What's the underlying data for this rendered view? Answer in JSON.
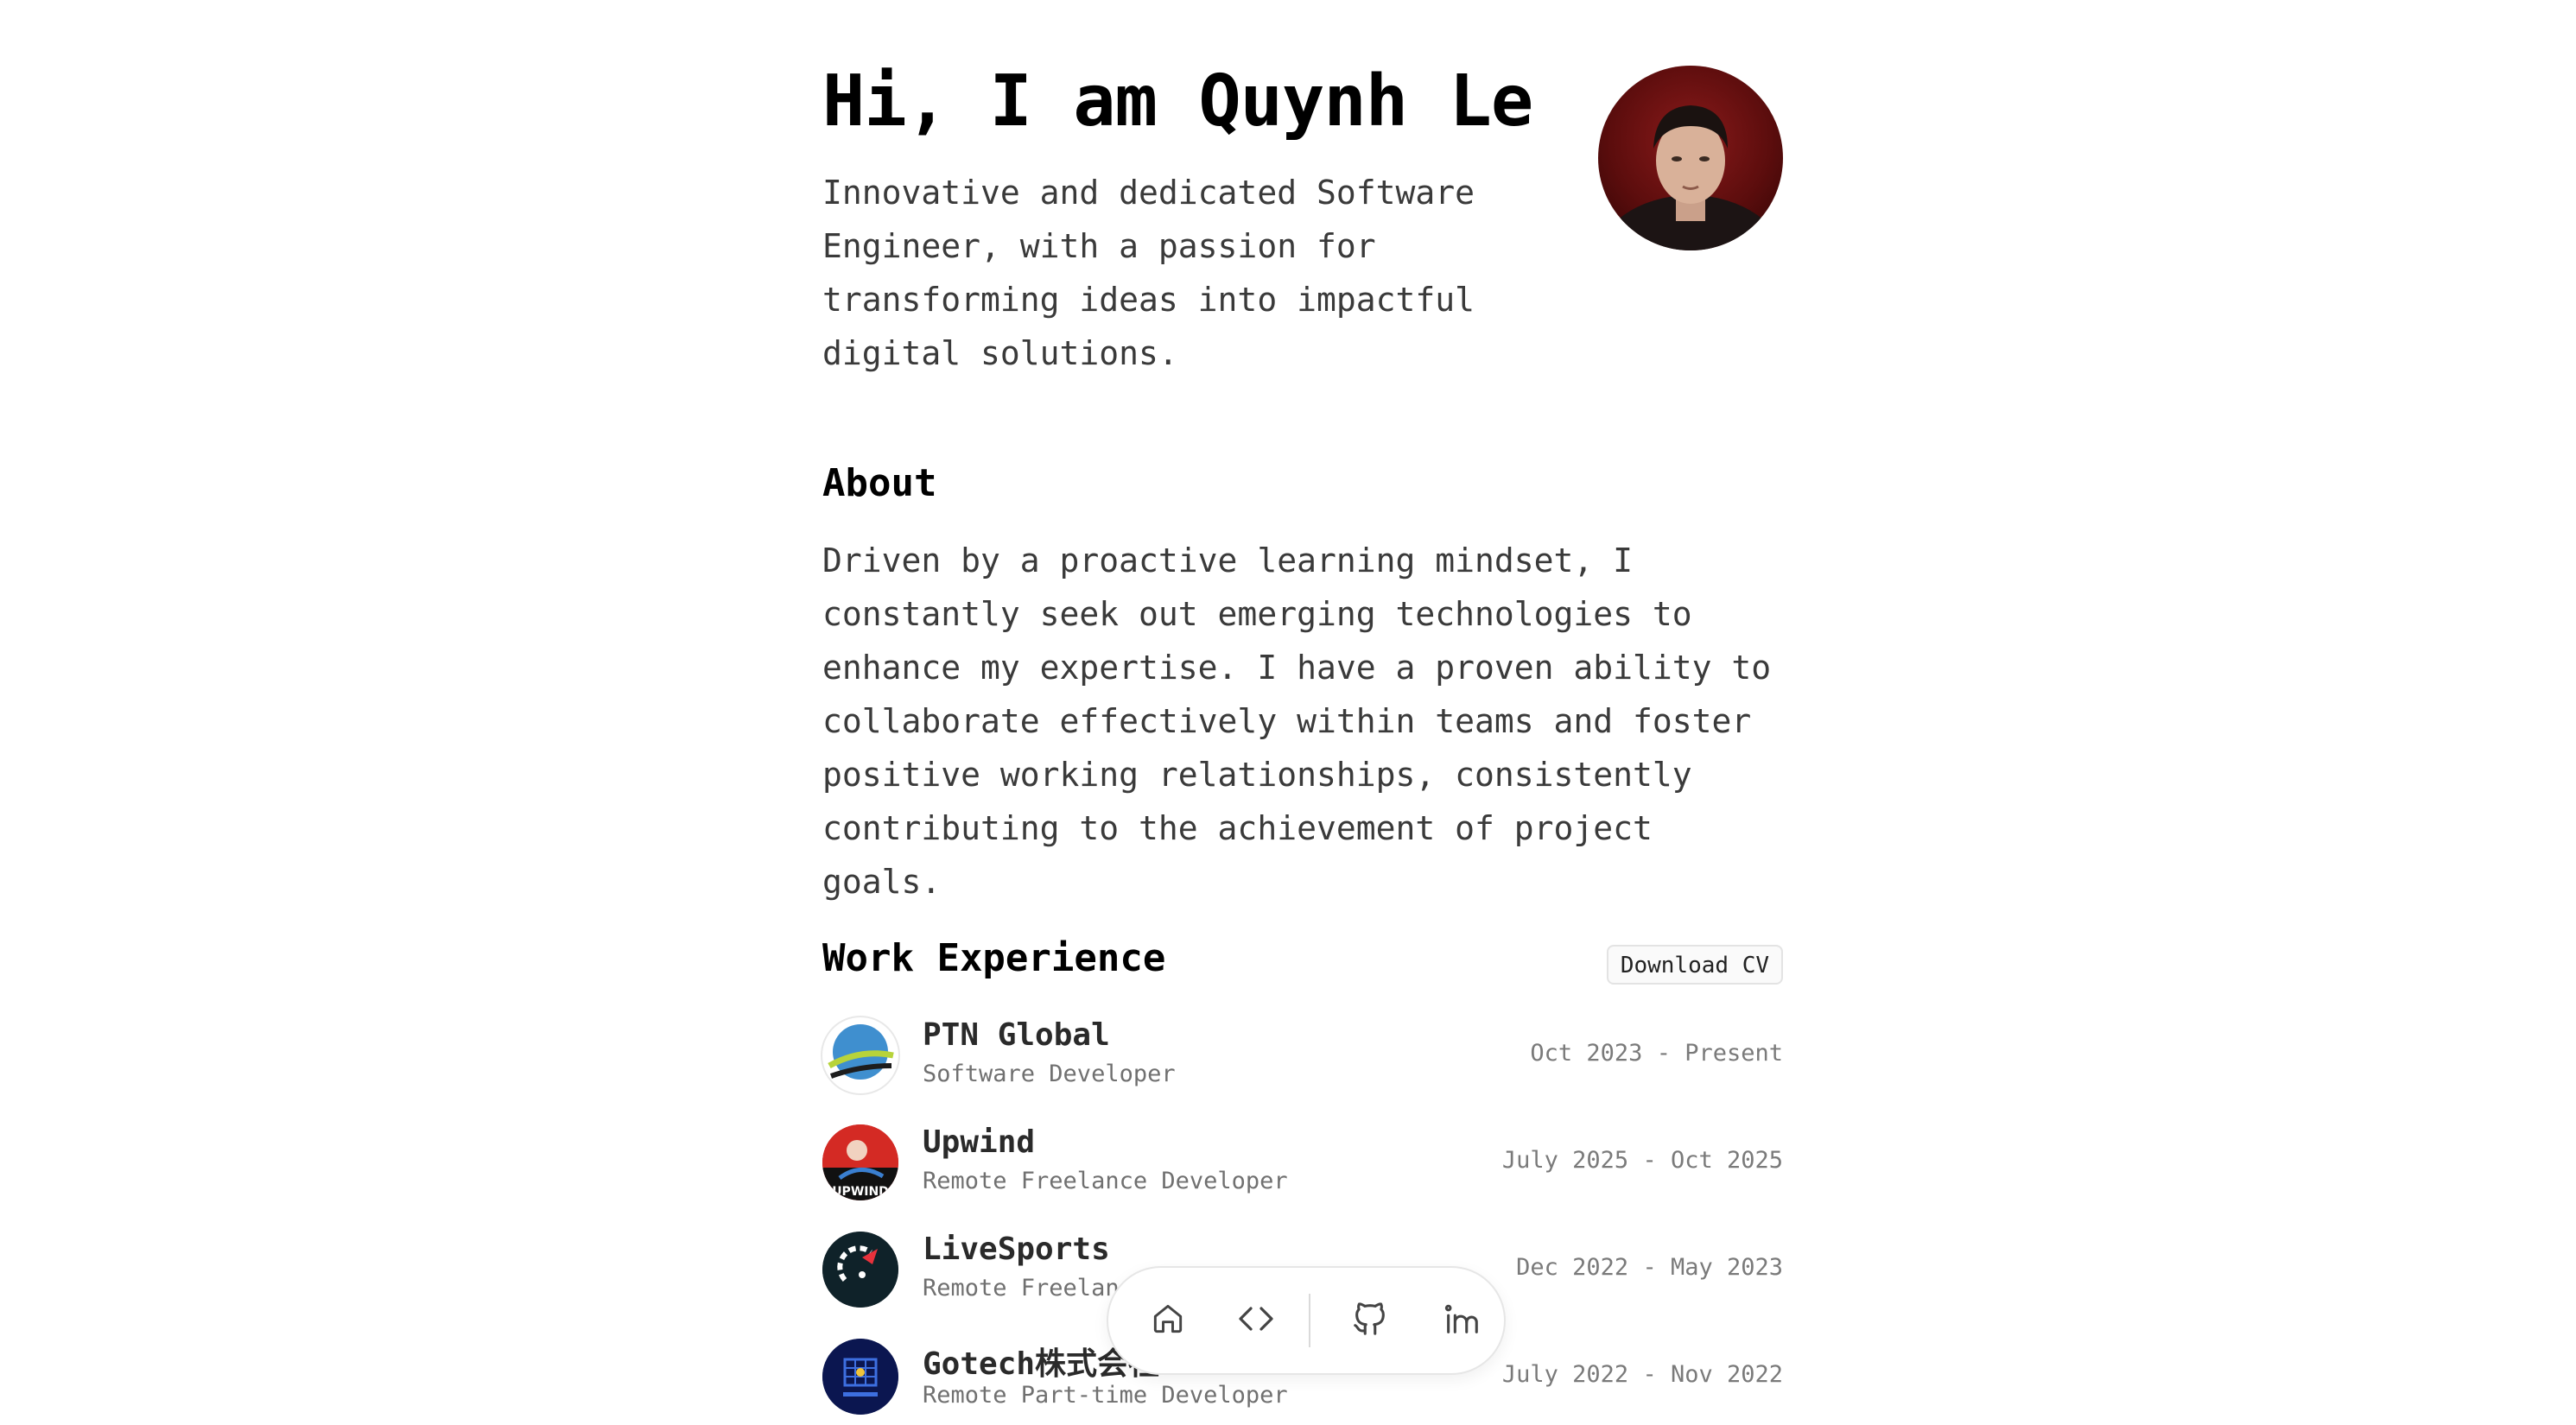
{
  "hero": {
    "title": "Hi, I am Quynh Le",
    "subtitle": "Innovative and dedicated Software Engineer, with a passion for transforming ideas into impactful digital solutions."
  },
  "about": {
    "heading": "About",
    "body": "Driven by a proactive learning mindset, I constantly seek out emerging technologies to enhance my expertise. I have a proven ability to collaborate effectively within teams and foster positive working relationships, consistently contributing to the achievement of project goals."
  },
  "work": {
    "heading": "Work Experience",
    "download_label": "Download CV",
    "jobs": [
      {
        "company": "PTN Global",
        "role": "Software Developer",
        "dates": "Oct 2023 - Present"
      },
      {
        "company": "Upwind",
        "role": "Remote Freelance Developer",
        "dates": "July 2025 - Oct 2025"
      },
      {
        "company": "LiveSports",
        "role": "Remote Freelance Developer",
        "dates": "Dec 2022 - May 2023"
      },
      {
        "company": "Gotech株式会社",
        "role": "Remote Part-time Developer",
        "dates": "July 2022 - Nov 2022"
      }
    ]
  },
  "dock": {
    "items": [
      {
        "icon": "home-icon"
      },
      {
        "icon": "code-icon"
      },
      {
        "icon": "github-icon"
      },
      {
        "icon": "linkedin-icon"
      }
    ]
  }
}
